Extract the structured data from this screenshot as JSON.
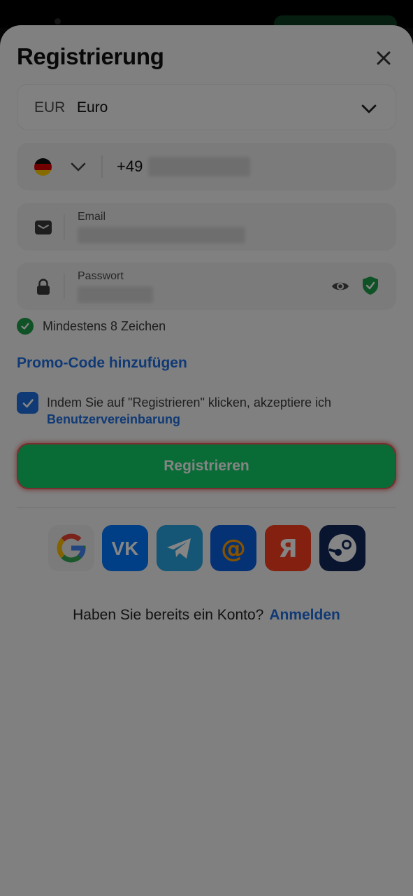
{
  "header": {
    "title": "Registrierung"
  },
  "currency": {
    "code": "EUR",
    "name": "Euro"
  },
  "phone": {
    "prefix": "+49"
  },
  "email": {
    "label": "Email"
  },
  "password": {
    "label": "Passwort"
  },
  "hint": {
    "text": "Mindestens 8 Zeichen"
  },
  "promo": {
    "label": "Promo-Code hinzufügen"
  },
  "terms": {
    "text": "Indem Sie auf \"Registrieren\" klicken, akzeptiere ich",
    "link": "Benutzervereinbarung"
  },
  "register": {
    "label": "Registrieren"
  },
  "socials": [
    "google-icon",
    "vk-icon",
    "telegram-icon",
    "mail-ru-icon",
    "yandex-icon",
    "steam-icon"
  ],
  "login": {
    "question": "Haben Sie bereits ein Konto?",
    "link": "Anmelden"
  },
  "colors": {
    "accent": "#1f6fe0",
    "primary_button": "#13ce66",
    "success": "#1e9e4a"
  }
}
